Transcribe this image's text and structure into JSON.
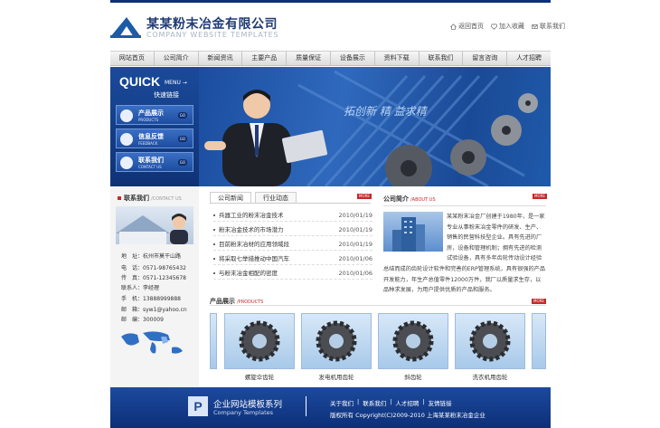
{
  "colors": {
    "brand_blue": "#1c4a9d",
    "dark_blue": "#0d2f78",
    "accent_red": "#c42a2a"
  },
  "header": {
    "company_cn": "某某粉末冶金有限公司",
    "company_en": "COMPANY WEBSITE TEMPLATES",
    "links": [
      {
        "label": "返回首页",
        "icon": "home-icon"
      },
      {
        "label": "加入收藏",
        "icon": "favorite-icon"
      },
      {
        "label": "联系我们",
        "icon": "contact-icon"
      }
    ]
  },
  "nav": [
    "网站首页",
    "公司简介",
    "新闻资讯",
    "主要产品",
    "质量保证",
    "设备展示",
    "资料下载",
    "联系我们",
    "留言咨询",
    "人才招聘"
  ],
  "quick": {
    "title": "QUICK",
    "menu": "MENU →",
    "subtitle": "快速链接",
    "buttons": [
      {
        "cn": "产品展示",
        "en": "PRODUCTS",
        "go": "GO"
      },
      {
        "cn": "信息反馈",
        "en": "FEEDBACK",
        "go": "GO"
      },
      {
        "cn": "联系我们",
        "en": "CONTACT US",
        "go": "GO"
      }
    ]
  },
  "banner": {
    "slogan": "拓创新 精 益求精"
  },
  "contact": {
    "title": "联系我们",
    "title_en": "/CONTACT US",
    "rows": [
      "地　址：杭州市莫干山路",
      "电　话：0571-98765432",
      "传　真：0571-12345678",
      "联系人：李经理",
      "手　机：13888999888",
      "邮　箱：syw1@yahoo.cn",
      "邮　编：300009"
    ]
  },
  "news": {
    "tabs": [
      "公司新闻",
      "行业动态"
    ],
    "more": "MORE",
    "items": [
      {
        "title": "兵器工业的粉末冶金技术",
        "date": "2010/01/19"
      },
      {
        "title": "粉末冶金技术的市场潜力",
        "date": "2010/01/19"
      },
      {
        "title": "目前粉末冶材的应用领域段",
        "date": "2010/01/19"
      },
      {
        "title": "将采取七举措推动中国汽车",
        "date": "2010/01/06"
      },
      {
        "title": "与粉末冶金相配的密度",
        "date": "2010/01/06"
      }
    ]
  },
  "about": {
    "title": "公司简介",
    "title_en": "/ABOUT US",
    "more": "MORE",
    "text": "某某粉末冶金厂创建于1980年，是一家专业从事粉末冶金零件的研发、生产、销售的民营科技型企业。具有先进的厂房，设备和管理机制；拥有先进的检测试验设备，具有多年齿轮传动设计经验总结而成的齿轮设计软件和完善的ERP管理系统，具有很强的产品开发能力，年生产总值零件12000万件，我厂以质量求生存，以品种求发展，为用户提供优质的产品和服务。"
  },
  "products": {
    "title": "产品展示",
    "title_en": "/PRODUCTS",
    "more": "MORE",
    "items": [
      "螺旋伞齿轮",
      "发电机用齿轮",
      "斜齿轮",
      "洗衣机用齿轮"
    ]
  },
  "footer": {
    "logo_letter": "P",
    "title_cn": "企业网站模板系列",
    "title_en": "Company Templates",
    "links": [
      "关于我们",
      "联系我们",
      "人才招聘",
      "友情链接"
    ],
    "copyright": "版权所有 Copyright(C)2009-2010 上海某某粉末冶金企业"
  }
}
